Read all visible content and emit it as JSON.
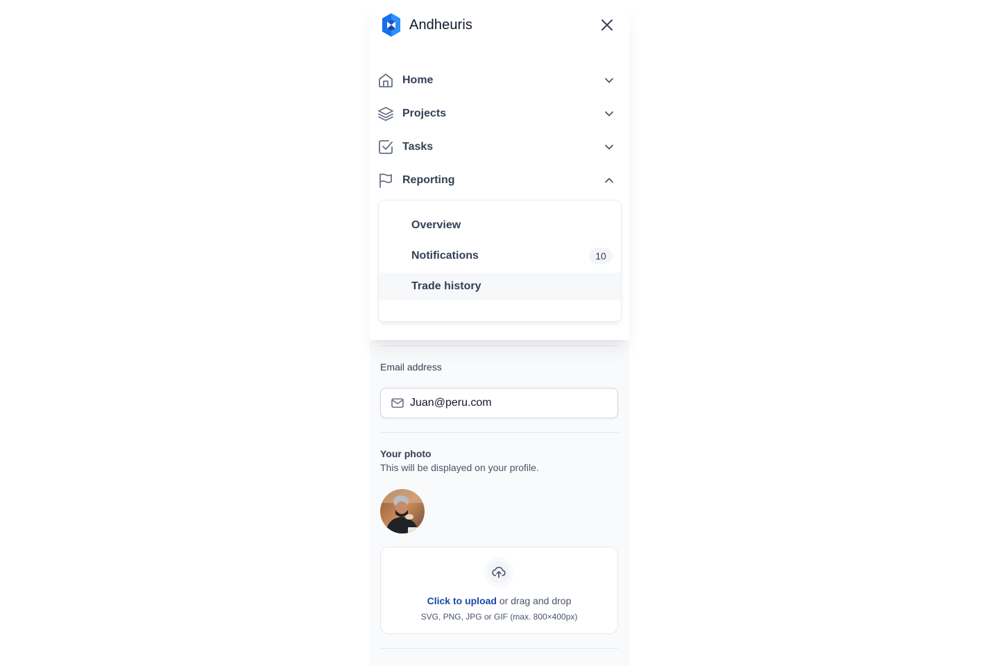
{
  "brand": {
    "name": "Andheuris",
    "accent": "#1570ef"
  },
  "nav": {
    "items": [
      {
        "label": "Home",
        "icon": "home-icon",
        "expanded": false
      },
      {
        "label": "Projects",
        "icon": "layers-icon",
        "expanded": false
      },
      {
        "label": "Tasks",
        "icon": "check-square-icon",
        "expanded": false
      },
      {
        "label": "Reporting",
        "icon": "flag-icon",
        "expanded": true
      }
    ],
    "reporting_sub": [
      {
        "label": "Overview"
      },
      {
        "label": "Notifications",
        "badge": "10"
      },
      {
        "label": "Trade history",
        "active": true
      }
    ]
  },
  "settings": {
    "email": {
      "label": "Email address",
      "value": "Juan@peru.com"
    },
    "photo": {
      "title": "Your photo",
      "subtitle": "This will be displayed on your profile."
    },
    "upload": {
      "link_text": "Click to upload",
      "rest_text": " or drag and drop",
      "hint": "SVG, PNG, JPG or GIF (max. 800×400px)"
    }
  }
}
